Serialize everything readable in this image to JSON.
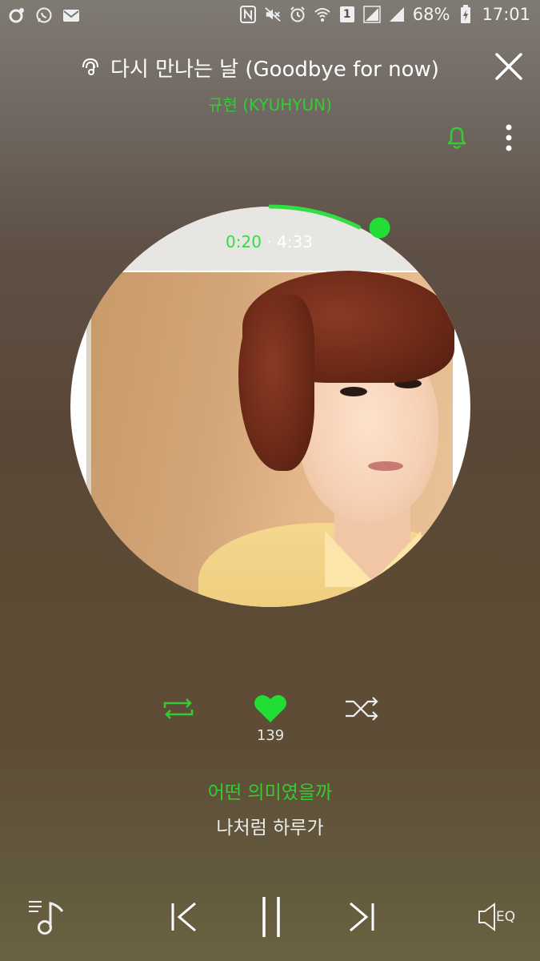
{
  "status_bar": {
    "battery": "68%",
    "time": "17:01",
    "sim": "1",
    "icons_left": [
      "app-icon",
      "whatsapp-icon",
      "mail-icon"
    ],
    "icons_right": [
      "nfc-icon",
      "mute-icon",
      "alarm-icon",
      "wifi-icon",
      "sim-icon",
      "signal-icon",
      "signal-icon",
      "battery-charging-icon"
    ]
  },
  "player": {
    "title": "다시 만나는 날 (Goodbye for now)",
    "artist": "규현 (KYUHYUN)",
    "current_time": "0:20",
    "total_time": "4:33",
    "separator": " · ",
    "progress": 0.073,
    "like_count": "139",
    "liked": true
  },
  "lyrics": {
    "current": "어떤 의미였을까",
    "next": "나처럼 하루가"
  },
  "controls": {
    "eq_label": "EQ"
  },
  "colors": {
    "accent": "#33cc33",
    "accent_bright": "#22dd33",
    "text": "#ffffff"
  }
}
